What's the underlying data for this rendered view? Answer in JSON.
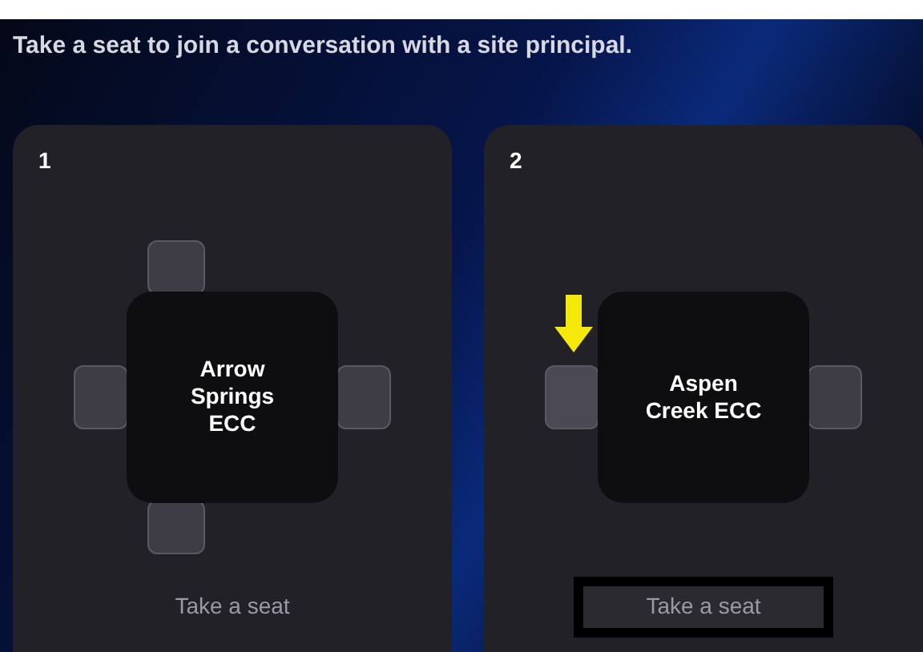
{
  "instruction": "Take a seat to join a conversation with a site principal.",
  "tables": [
    {
      "number": "1",
      "name": "Arrow Springs ECC",
      "seats": [
        {
          "kind": "top",
          "marked": false
        },
        {
          "kind": "left",
          "marked": false
        },
        {
          "kind": "right",
          "marked": false
        },
        {
          "kind": "bottom",
          "marked": false
        }
      ],
      "button": {
        "label": "Take a seat",
        "highlighted": false
      }
    },
    {
      "number": "2",
      "name": "Aspen Creek ECC",
      "seats": [
        {
          "kind": "left",
          "marked": true
        },
        {
          "kind": "right",
          "marked": false
        }
      ],
      "button": {
        "label": "Take a seat",
        "highlighted": true
      }
    }
  ]
}
